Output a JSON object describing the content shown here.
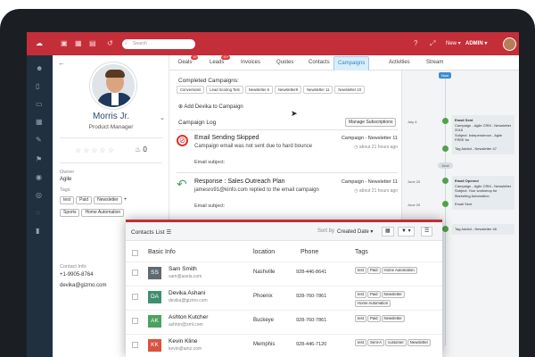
{
  "topbar": {
    "search_placeholder": "Search",
    "new_label": "New",
    "admin_label": "ADMIN",
    "notif_badge": "1"
  },
  "profile": {
    "name": "Morris Jr.",
    "title": "Product Manager",
    "score": "0",
    "owner_label": "Owner",
    "owner_value": "Agile",
    "tags_label": "Tags",
    "tags": [
      "test",
      "Paid",
      "Newsletter",
      "Sports",
      "Home Automation"
    ],
    "contact_label": "Contact Info",
    "phone": "+1-9905-8764",
    "email": "devika@gizmo.com"
  },
  "tabs": [
    {
      "label": "Deals",
      "badge": "10"
    },
    {
      "label": "Leads",
      "badge": "10+"
    },
    {
      "label": "Invoices"
    },
    {
      "label": "Quotes"
    },
    {
      "label": "Contacts"
    },
    {
      "label": "Campaigns"
    },
    {
      "label": "Activities"
    },
    {
      "label": "Stream"
    }
  ],
  "campaigns": {
    "completed_label": "Completed Campaigns:",
    "completed": [
      "Conversions",
      "Lead Scoring Test",
      "Newsletter 6",
      "Newsletter9",
      "Newsletter 11",
      "Newsletter 10"
    ],
    "add_label": "Add Devika to Campaign",
    "log_label": "Campaign Log",
    "manage_label": "Manage Subscriptions",
    "log": [
      {
        "title": "Email Sending Skipped",
        "desc": "Campaign email was not sent due to hard bounce",
        "campaign": "Campaign - Newsletter 11",
        "time": "about 21 hours ago",
        "subject": "Email subject:"
      },
      {
        "title": "Response : Sales Outreach Plan",
        "desc": "jamesro91@kinfo.com replied to the email campaign",
        "campaign": "Campaign - Newsletter 11",
        "time": "about 21 hours ago",
        "subject": "Email subject:"
      }
    ]
  },
  "timeline": {
    "now": "Now",
    "june": "June",
    "dates": [
      "July 4",
      "June 20",
      "June 20",
      "June 20",
      "June 14"
    ],
    "cards": [
      {
        "t": "Email Sent",
        "d": "Campaign - Agile CRM - Newsletter 2018",
        "d2": "Subject: Independence - Agile FREE for"
      },
      {
        "t": "Tag Added - Newsletter 47"
      },
      {
        "t": "Email Opened",
        "d": "Campaign - Agile CRM - Newsletter",
        "d2": "Subject: Your workshop for Marketing Automation"
      },
      {
        "t": "Email Sent"
      },
      {
        "t": "Tag Added - Newsletter 46"
      }
    ]
  },
  "contacts_list": {
    "title": "Contacts List",
    "sort_label": "Sort by",
    "sort_value": "Created Date",
    "headers": [
      "Basic Info",
      "location",
      "Phone",
      "Tags"
    ],
    "rows": [
      {
        "initials": "SS",
        "color": "#5f6b73",
        "name": "Sam Smith",
        "email": "sam@asela.com",
        "location": "Nashville",
        "phone": "928-446-8641",
        "tags": [
          "test",
          "Paid",
          "Home Automation"
        ]
      },
      {
        "initials": "DA",
        "color": "#3f8f6e",
        "name": "Devika Ashani",
        "email": "devika@gizmo.com",
        "location": "Phoenix",
        "phone": "928-760-7861",
        "tags": [
          "test",
          "Paid",
          "Newsletter",
          "Home Automation"
        ]
      },
      {
        "initials": "AK",
        "color": "#4aa35c",
        "name": "Ashton Kutcher",
        "email": "ashton@xml.com",
        "location": "Buckeye",
        "phone": "928-760-7861",
        "tags": [
          "test",
          "Paid",
          "Newsletter"
        ]
      },
      {
        "initials": "KK",
        "color": "#d9533e",
        "name": "Kevin Kline",
        "email": "kevin@amz.com",
        "location": "Memphis",
        "phone": "928-446-7120",
        "tags": [
          "test",
          "Sent-A",
          "customer",
          "Newsletter"
        ]
      }
    ]
  }
}
